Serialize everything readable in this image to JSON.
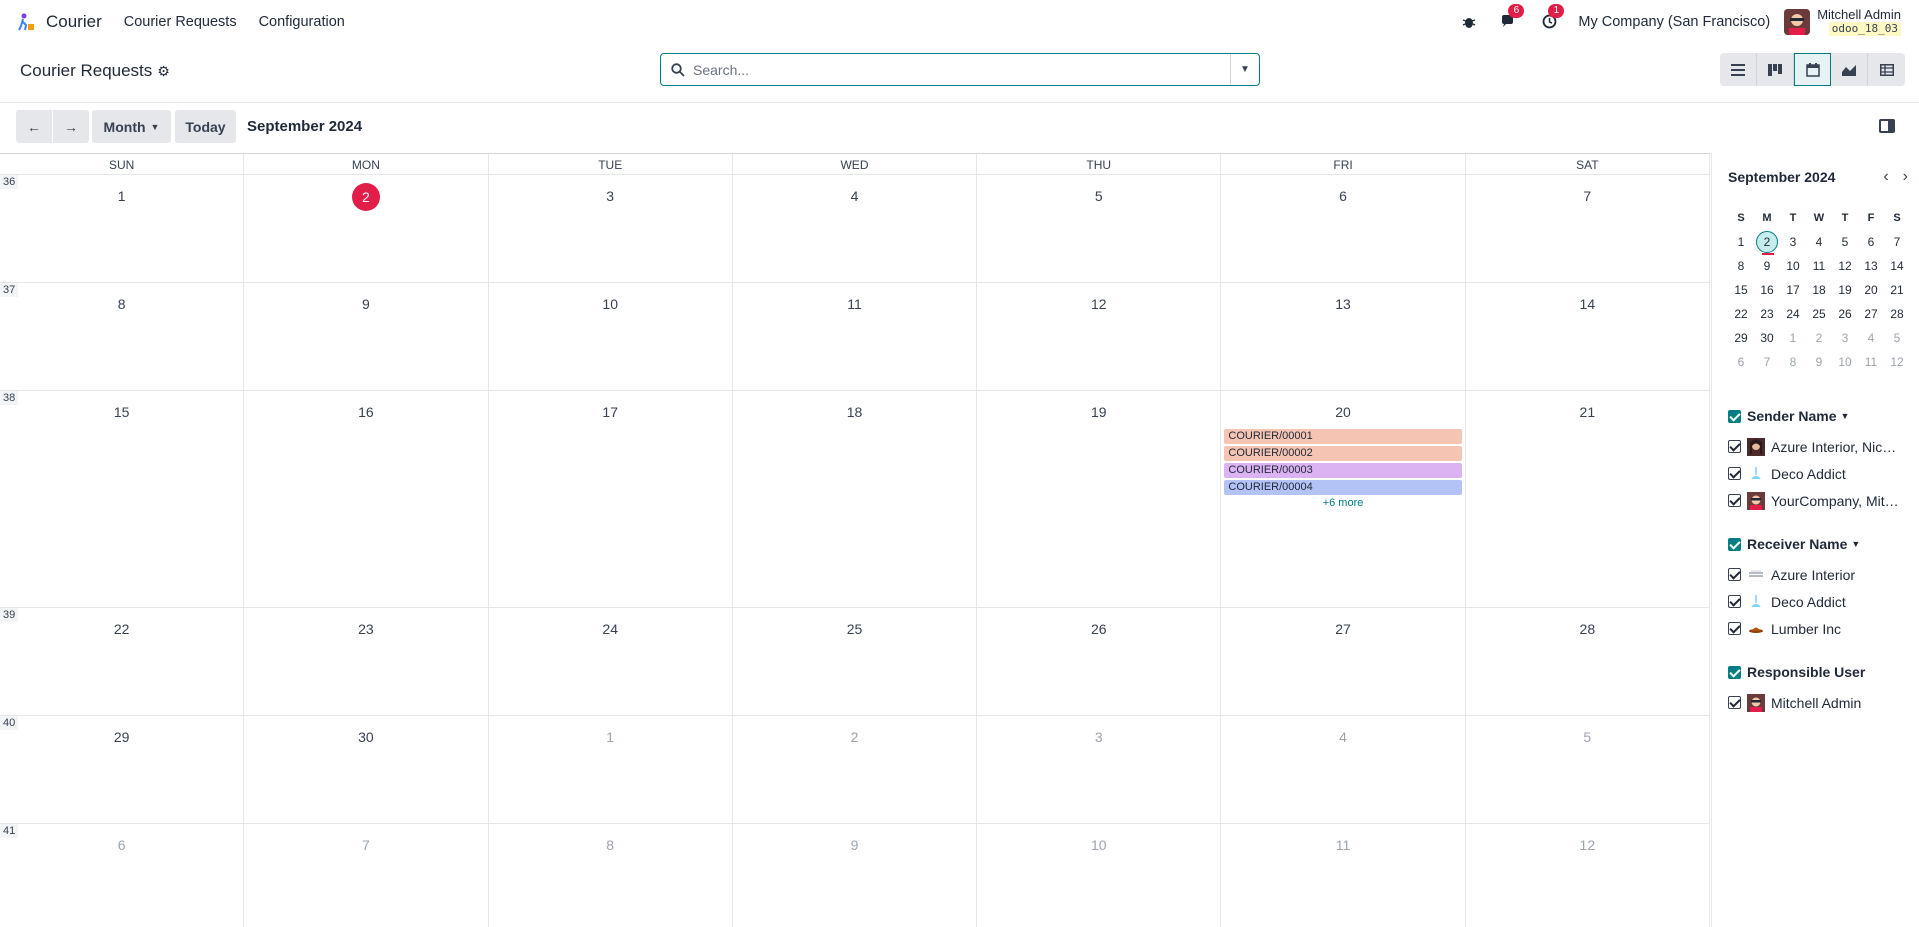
{
  "navbar": {
    "app_name": "Courier",
    "menu": [
      "Courier Requests",
      "Configuration"
    ],
    "chat_badge": "6",
    "activity_badge": "1",
    "company": "My Company (San Francisco)",
    "user_name": "Mitchell Admin",
    "db_name": "odoo_18_03"
  },
  "control": {
    "breadcrumb": "Courier Requests",
    "search_placeholder": "Search..."
  },
  "toolbar": {
    "scale_label": "Month",
    "today_label": "Today",
    "title": "September 2024"
  },
  "calendar": {
    "weekdays": [
      "SUN",
      "MON",
      "TUE",
      "WED",
      "THU",
      "FRI",
      "SAT"
    ],
    "weeks": [
      {
        "num": "36",
        "days": [
          "1",
          "2",
          "3",
          "4",
          "5",
          "6",
          "7"
        ]
      },
      {
        "num": "37",
        "days": [
          "8",
          "9",
          "10",
          "11",
          "12",
          "13",
          "14"
        ]
      },
      {
        "num": "38",
        "days": [
          "15",
          "16",
          "17",
          "18",
          "19",
          "20",
          "21"
        ]
      },
      {
        "num": "39",
        "days": [
          "22",
          "23",
          "24",
          "25",
          "26",
          "27",
          "28"
        ]
      },
      {
        "num": "40",
        "days": [
          "29",
          "30",
          "1",
          "2",
          "3",
          "4",
          "5"
        ]
      },
      {
        "num": "41",
        "days": [
          "6",
          "7",
          "8",
          "9",
          "10",
          "11",
          "12"
        ]
      }
    ],
    "events": [
      {
        "label": "COURIER/00001",
        "color": "#f5c4b3"
      },
      {
        "label": "COURIER/00002",
        "color": "#f5c4b3"
      },
      {
        "label": "COURIER/00003",
        "color": "#dcb3f2"
      },
      {
        "label": "COURIER/00004",
        "color": "#b3c3f5"
      }
    ],
    "more_label": "+6 more",
    "today_color": "#e11d48"
  },
  "mini": {
    "title": "September 2024",
    "weekdays": [
      "S",
      "M",
      "T",
      "W",
      "T",
      "F",
      "S"
    ],
    "rows": [
      [
        "1",
        "2",
        "3",
        "4",
        "5",
        "6",
        "7"
      ],
      [
        "8",
        "9",
        "10",
        "11",
        "12",
        "13",
        "14"
      ],
      [
        "15",
        "16",
        "17",
        "18",
        "19",
        "20",
        "21"
      ],
      [
        "22",
        "23",
        "24",
        "25",
        "26",
        "27",
        "28"
      ],
      [
        "29",
        "30",
        "1",
        "2",
        "3",
        "4",
        "5"
      ],
      [
        "6",
        "7",
        "8",
        "9",
        "10",
        "11",
        "12"
      ]
    ]
  },
  "filters": [
    {
      "title": "Sender Name",
      "items": [
        "Azure Interior, Nicole Ford",
        "Deco Addict",
        "YourCompany, Mitchell Admin"
      ]
    },
    {
      "title": "Receiver Name",
      "items": [
        "Azure Interior",
        "Deco Addict",
        "Lumber Inc"
      ]
    },
    {
      "title": "Responsible User",
      "items": [
        "Mitchell Admin"
      ]
    }
  ],
  "accent_color": "#017e84"
}
